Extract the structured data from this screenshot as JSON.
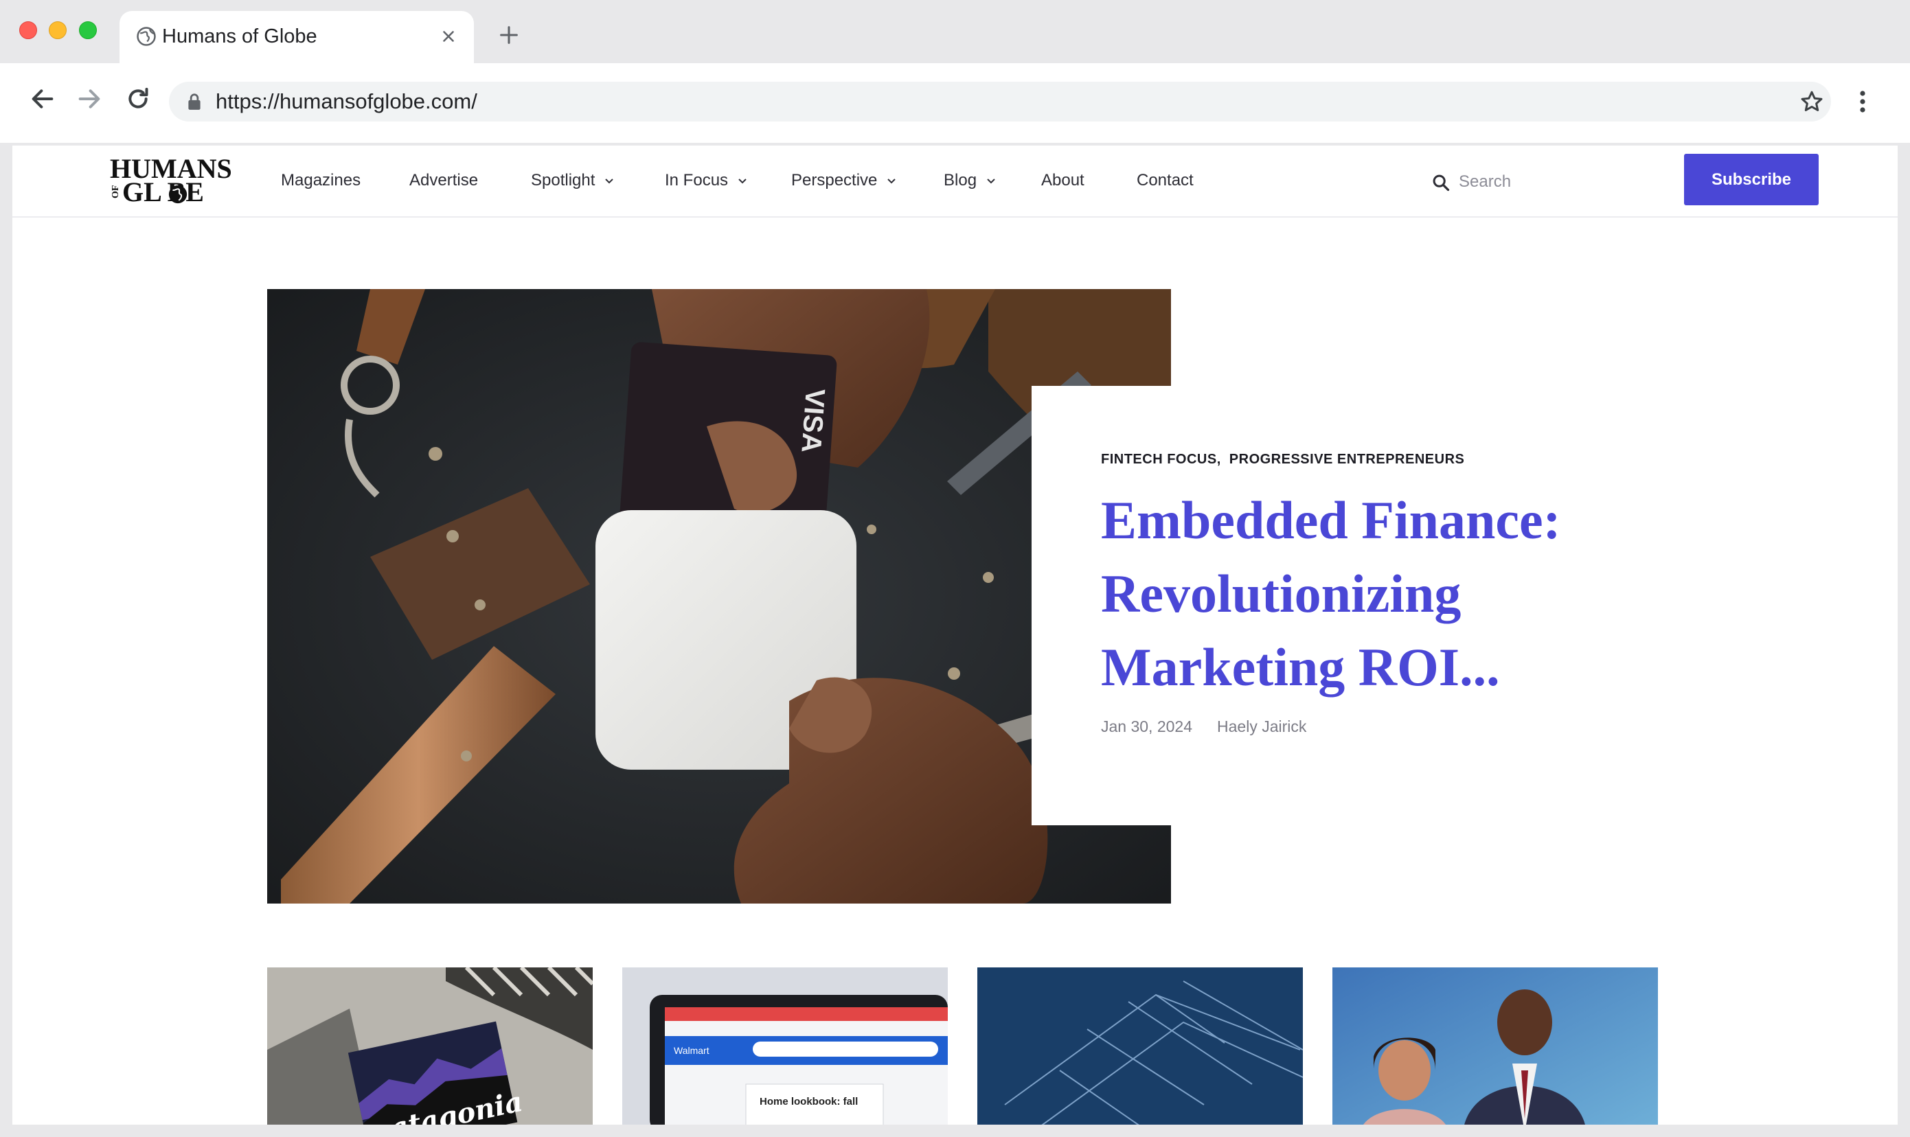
{
  "browser": {
    "tab_title": "Humans of Globe",
    "url": "https://humansofglobe.com/"
  },
  "site": {
    "logo_line1": "HUMANS",
    "logo_of": "OF",
    "logo_line2": "GL BE",
    "menu": [
      {
        "label": "Magazines",
        "dropdown": false
      },
      {
        "label": "Advertise",
        "dropdown": false
      },
      {
        "label": "Spotlight",
        "dropdown": true
      },
      {
        "label": "In Focus",
        "dropdown": true
      },
      {
        "label": "Perspective",
        "dropdown": true
      },
      {
        "label": "Blog",
        "dropdown": true
      },
      {
        "label": "About",
        "dropdown": false
      },
      {
        "label": "Contact",
        "dropdown": false
      }
    ],
    "search_placeholder": "Search",
    "subscribe_label": "Subscribe",
    "accent_color": "#4a47d6"
  },
  "hero": {
    "categories": [
      "FINTECH FOCUS,",
      "PROGRESSIVE ENTREPRENEURS"
    ],
    "headline": "Embedded Finance: Revolutionizing Marketing ROI...",
    "date": "Jan 30, 2024",
    "author": "Haely Jairick",
    "image_alt": "Hands tapping a credit card on a card reader"
  },
  "thumbnails": [
    {
      "alt": "Patagonia storefront sign"
    },
    {
      "alt": "Walmart website on a laptop screen"
    },
    {
      "alt": "Blue blueprint drawing"
    },
    {
      "alt": "Two people smiling at an event"
    }
  ]
}
